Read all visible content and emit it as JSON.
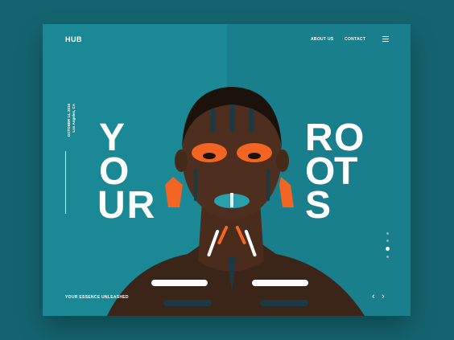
{
  "brand": {
    "logo": "HUB"
  },
  "nav": {
    "items": [
      {
        "label": "ABOUT US"
      },
      {
        "label": "CONTACT"
      }
    ],
    "menu_icon": "hamburger-menu-icon"
  },
  "hero": {
    "date_line1": "OCTOBER 14, 2016",
    "date_line2": "Los Angeles, CA",
    "headline_left": [
      "Y",
      "O",
      "UR"
    ],
    "headline_right": [
      "R",
      "O",
      "O",
      "T",
      "S"
    ],
    "tagline": "YOUR ESSENCE UNLEASHED"
  },
  "slider": {
    "total": 4,
    "active_index": 2,
    "prev_icon": "chevron-left-icon",
    "next_icon": "chevron-right-icon",
    "prev": "‹",
    "next": "›"
  },
  "colors": {
    "page_bg": "#14646f",
    "card_left": "#1b8895",
    "card_right": "#1a7f8c",
    "accent_orange": "#f26522",
    "text": "#ffffff"
  }
}
